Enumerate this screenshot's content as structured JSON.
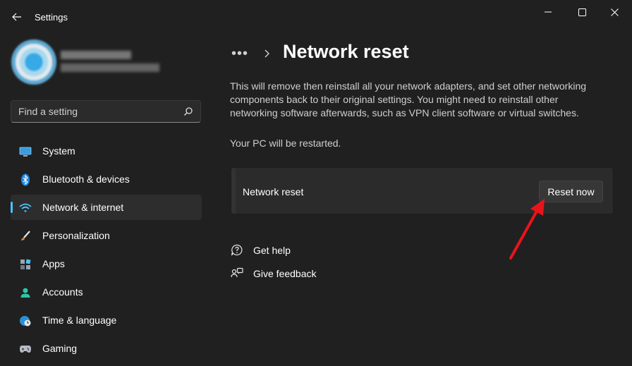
{
  "window": {
    "title": "Settings"
  },
  "search": {
    "placeholder": "Find a setting"
  },
  "sidebar": {
    "items": [
      {
        "label": "System",
        "icon": "monitor-icon",
        "active": false
      },
      {
        "label": "Bluetooth & devices",
        "icon": "bluetooth-icon",
        "active": false
      },
      {
        "label": "Network & internet",
        "icon": "wifi-icon",
        "active": true
      },
      {
        "label": "Personalization",
        "icon": "brush-icon",
        "active": false
      },
      {
        "label": "Apps",
        "icon": "apps-icon",
        "active": false
      },
      {
        "label": "Accounts",
        "icon": "person-icon",
        "active": false
      },
      {
        "label": "Time & language",
        "icon": "globe-clock-icon",
        "active": false
      },
      {
        "label": "Gaming",
        "icon": "gamepad-icon",
        "active": false
      }
    ]
  },
  "breadcrumb": {
    "ellipsis": "•••"
  },
  "main": {
    "title": "Network reset",
    "description": "This will remove then reinstall all your network adapters, and set other networking components back to their original settings. You might need to reinstall other networking software afterwards, such as VPN client software or virtual switches.",
    "restart_note": "Your PC will be restarted.",
    "card": {
      "label": "Network reset",
      "button_label": "Reset now"
    },
    "links": [
      {
        "label": "Get help",
        "icon": "help-chat-icon"
      },
      {
        "label": "Give feedback",
        "icon": "feedback-icon"
      }
    ]
  },
  "colors": {
    "background": "#202020",
    "accent": "#4cc2ff",
    "annotation_arrow": "#e8141c"
  }
}
